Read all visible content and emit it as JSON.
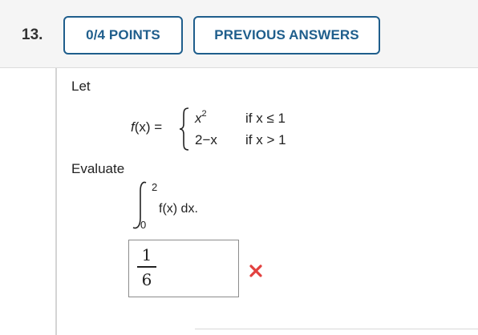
{
  "question": {
    "number": "13.",
    "points_label": "0/4 POINTS",
    "previous_answers_label": "PREVIOUS ANSWERS"
  },
  "problem": {
    "intro": "Let",
    "function_lhs": "f(x) =",
    "cases": [
      {
        "expr_base": "x",
        "expr_sup": "2",
        "condition": "if x ≤ 1"
      },
      {
        "expr_base": "2−x",
        "expr_sup": "",
        "condition": "if x > 1"
      }
    ],
    "evaluate_label": "Evaluate",
    "integral_upper": "2",
    "integral_lower": "0",
    "integrand": "f(x) dx."
  },
  "answer": {
    "numerator": "1",
    "denominator": "6",
    "status": "incorrect",
    "status_icon": "x-mark-icon",
    "status_color": "#e2413f"
  },
  "colors": {
    "button_accent": "#1f5e8c",
    "header_bg": "#f5f5f5"
  }
}
